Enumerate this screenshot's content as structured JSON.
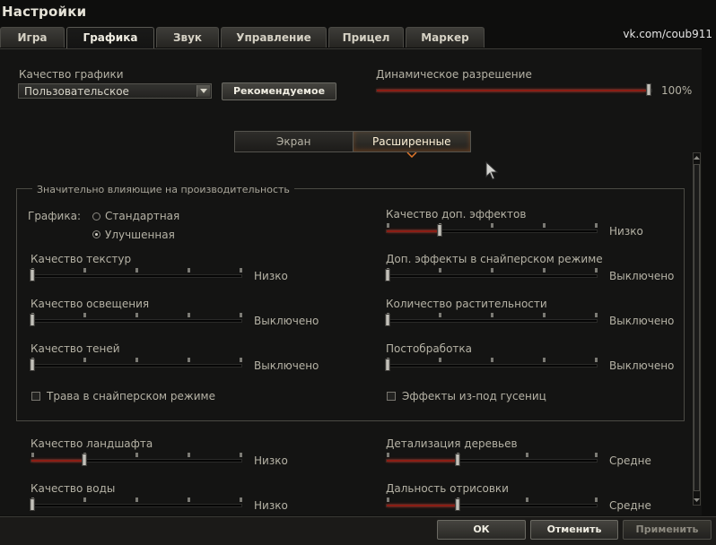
{
  "window": {
    "title": "Настройки",
    "watermark": "vk.com/coub911"
  },
  "tabs": [
    {
      "label": "Игра",
      "active": false
    },
    {
      "label": "Графика",
      "active": true
    },
    {
      "label": "Звук",
      "active": false
    },
    {
      "label": "Управление",
      "active": false
    },
    {
      "label": "Прицел",
      "active": false
    },
    {
      "label": "Маркер",
      "active": false
    }
  ],
  "quality": {
    "label": "Качество графики",
    "value": "Пользовательское",
    "recommended": "Рекомендуемое"
  },
  "dynamic_resolution": {
    "label": "Динамическое разрешение",
    "value": "100%",
    "level": 1.0
  },
  "mode_switch": {
    "screen": "Экран",
    "advanced": "Расширенные"
  },
  "group": {
    "title": "Значительно влияющие на производительность",
    "graphics_label": "Графика:",
    "radio_standard": "Стандартная",
    "radio_improved": "Улучшенная",
    "grass_sniper": "Трава в снайперском режиме",
    "track_effects": "Эффекты из-под гусениц"
  },
  "sliders": {
    "texture": {
      "label": "Качество текстур",
      "value": "Низко",
      "level": 0.0
    },
    "lighting": {
      "label": "Качество освещения",
      "value": "Выключено",
      "level": 0.0
    },
    "shadows": {
      "label": "Качество теней",
      "value": "Выключено",
      "level": 0.0
    },
    "extra_effects": {
      "label": "Качество доп. эффектов",
      "value": "Низко",
      "level": 0.25
    },
    "sniper_effects": {
      "label": "Доп. эффекты в снайперском режиме",
      "value": "Выключено",
      "level": 0.0
    },
    "vegetation": {
      "label": "Количество растительности",
      "value": "Выключено",
      "level": 0.0
    },
    "postprocess": {
      "label": "Постобработка",
      "value": "Выключено",
      "level": 0.0
    },
    "terrain": {
      "label": "Качество ландшафта",
      "value": "Низко",
      "level": 0.25
    },
    "trees": {
      "label": "Детализация деревьев",
      "value": "Средне",
      "level": 0.33
    },
    "water": {
      "label": "Качество воды",
      "value": "Низко",
      "level": 0.0
    },
    "draw_distance": {
      "label": "Дальность отрисовки",
      "value": "Средне",
      "level": 0.33
    }
  },
  "buttons": {
    "ok": "ОК",
    "cancel": "Отменить",
    "apply": "Применить"
  },
  "colors": {
    "accent_fill": "#8c1d14",
    "panel_bg": "#141413"
  }
}
